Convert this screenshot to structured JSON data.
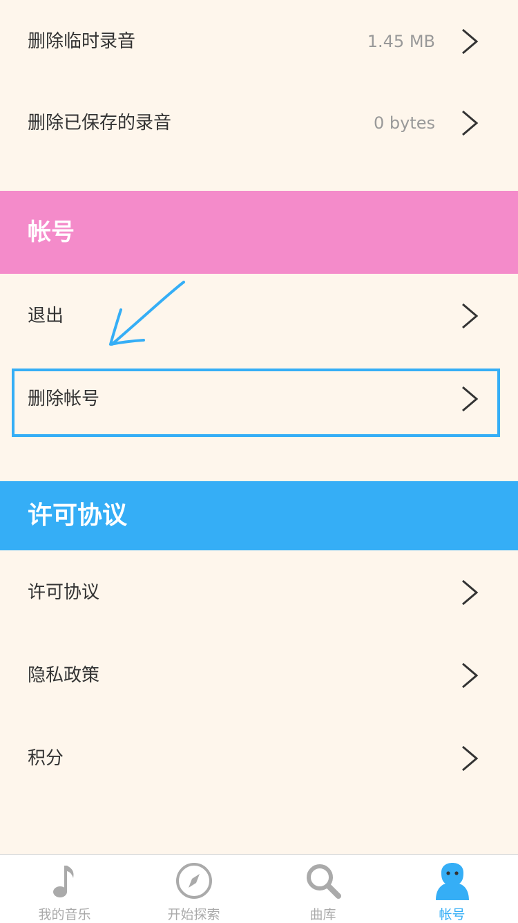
{
  "storage": {
    "delete_temp_label": "删除临时录音",
    "delete_temp_value": "1.45 MB",
    "delete_saved_label": "删除已保存的录音",
    "delete_saved_value": "0 bytes"
  },
  "account_section": {
    "title": "帐号",
    "color": "#F48BCA",
    "logout_label": "退出",
    "delete_account_label": "删除帐号"
  },
  "license_section": {
    "title": "许可协议",
    "color": "#35AEF6",
    "license_label": "许可协议",
    "privacy_label": "隐私政策",
    "credits_label": "积分"
  },
  "annotation": {
    "highlight_color": "#35AEF6"
  },
  "tabbar": {
    "active_color": "#35AEF6",
    "inactive_color": "#AAAAAA",
    "tabs": [
      {
        "label": "我的音乐",
        "icon": "music-note-icon",
        "active": false
      },
      {
        "label": "开始探索",
        "icon": "compass-icon",
        "active": false
      },
      {
        "label": "曲库",
        "icon": "search-icon",
        "active": false
      },
      {
        "label": "帐号",
        "icon": "account-person-icon",
        "active": true
      }
    ]
  }
}
